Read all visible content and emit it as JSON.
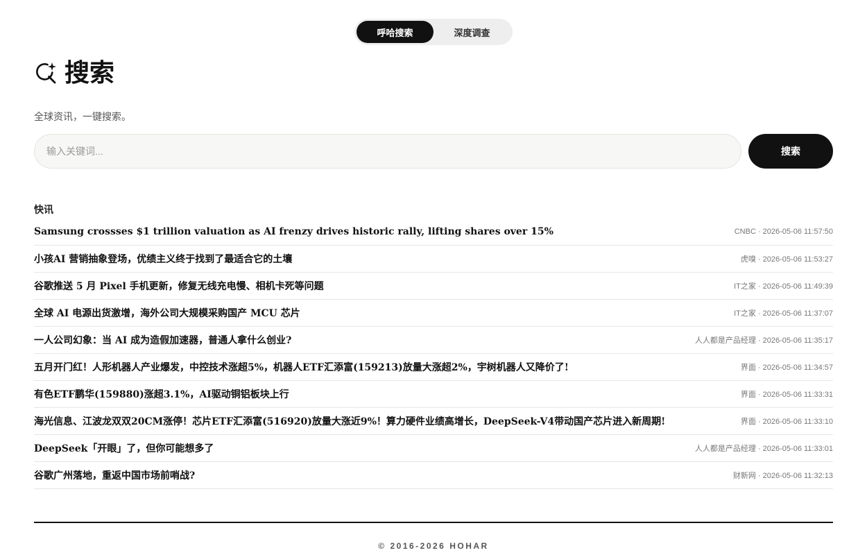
{
  "mode_switch": {
    "tabs": [
      {
        "label": "呼哈搜索",
        "active": true
      },
      {
        "label": "深度调查",
        "active": false
      }
    ]
  },
  "header": {
    "icon": "search-sparkle-icon",
    "title": "搜索",
    "subtitle": "全球资讯，一键搜索。"
  },
  "search": {
    "placeholder": "输入关键词...",
    "value": "",
    "button_label": "搜索"
  },
  "news": {
    "section_label": "快讯",
    "items": [
      {
        "title": "Samsung crossses $1 trillion valuation as AI frenzy drives historic rally, lifting shares over 15%",
        "meta": "CNBC · 2026-05-06 11:57:50"
      },
      {
        "title": "小孩AI 营销抽象登场，优绩主义终于找到了最适合它的土壤",
        "meta": "虎嗅 · 2026-05-06 11:53:27"
      },
      {
        "title": "谷歌推送 5 月 Pixel 手机更新，修复无线充电慢、相机卡死等问题",
        "meta": "IT之家 · 2026-05-06 11:49:39"
      },
      {
        "title": "全球 AI 电源出货激增，海外公司大规模采购国产 MCU 芯片",
        "meta": "IT之家 · 2026-05-06 11:37:07"
      },
      {
        "title": "一人公司幻象：当 AI 成为造假加速器，普通人拿什么创业?",
        "meta": "人人都是产品经理 · 2026-05-06 11:35:17"
      },
      {
        "title": "五月开门红！人形机器人产业爆发，中控技术涨超5%，机器人ETF汇添富(159213)放量大涨超2%，宇树机器人又降价了!",
        "meta": "界面 · 2026-05-06 11:34:57"
      },
      {
        "title": "有色ETF鹏华(159880)涨超3.1%，AI驱动铜铝板块上行",
        "meta": "界面 · 2026-05-06 11:33:31"
      },
      {
        "title": "海光信息、江波龙双双20CM涨停！芯片ETF汇添富(516920)放量大涨近9%！算力硬件业绩高增长，DeepSeek-V4带动国产芯片进入新周期!",
        "meta": "界面 · 2026-05-06 11:33:10"
      },
      {
        "title": "DeepSeek「开眼」了，但你可能想多了",
        "meta": "人人都是产品经理 · 2026-05-06 11:33:01"
      },
      {
        "title": "谷歌广州落地，重返中国市场前哨战?",
        "meta": "财新网 · 2026-05-06 11:32:13"
      }
    ]
  },
  "footer": {
    "copyright": "© 2016-2026 HOHAR"
  }
}
